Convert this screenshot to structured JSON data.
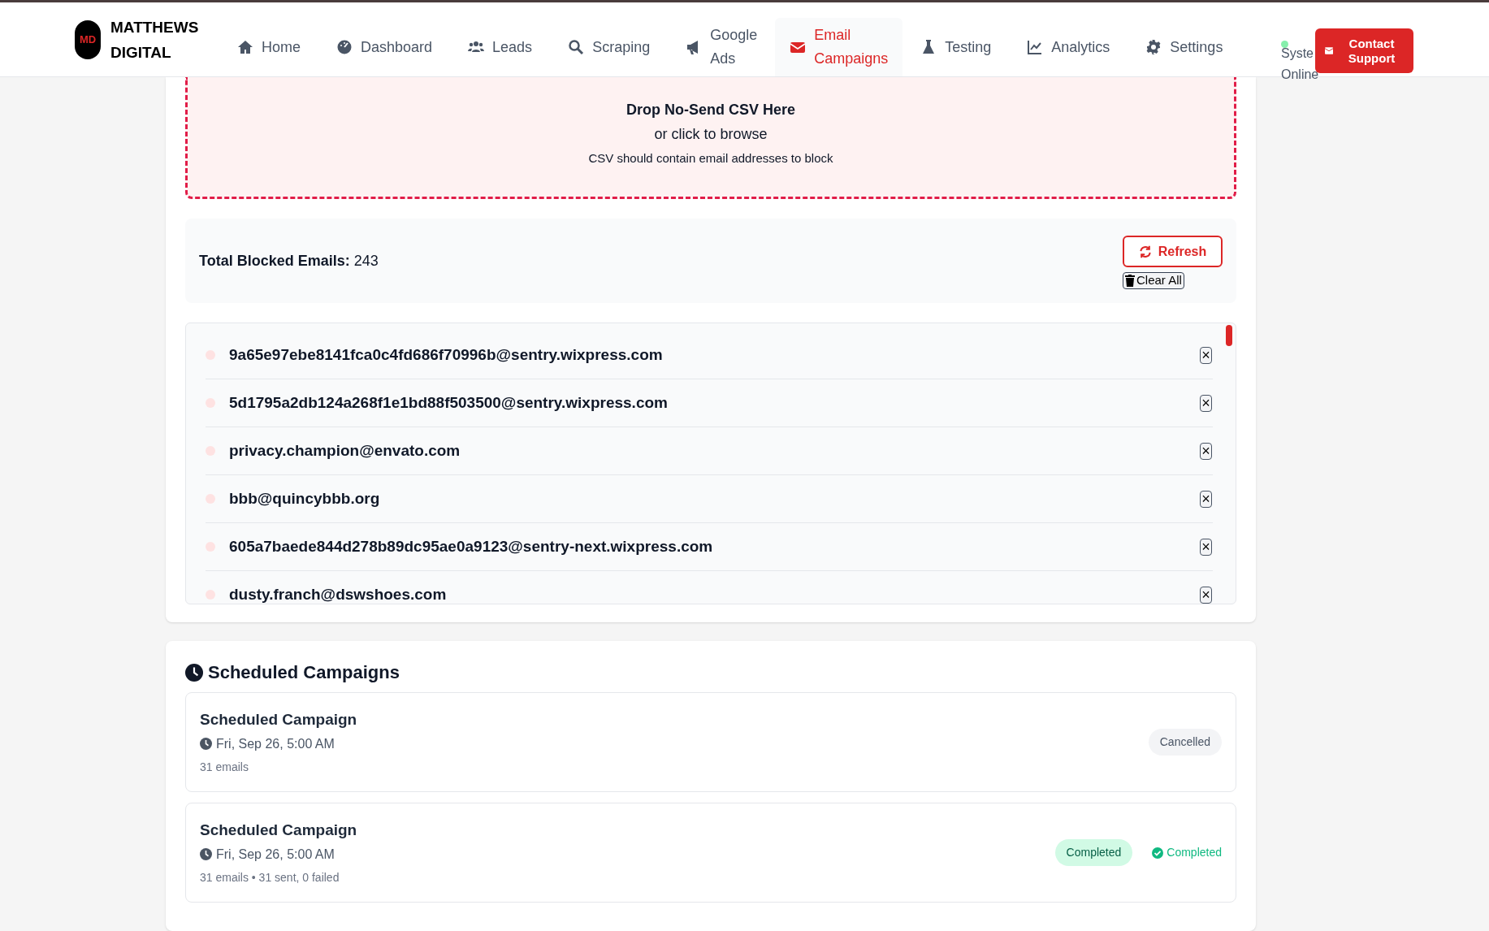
{
  "brand": {
    "logo": "MD",
    "name_lines": [
      "MATTHEWS",
      "DIGITAL"
    ]
  },
  "nav": [
    {
      "label": "Home",
      "selected": false
    },
    {
      "label": "Dashboard",
      "selected": false
    },
    {
      "label": "Leads",
      "selected": false
    },
    {
      "label": "Scraping",
      "selected": false
    },
    {
      "label": "Google Ads",
      "selected": false
    },
    {
      "label": "Email Campaigns",
      "selected": true
    },
    {
      "label": "Testing",
      "selected": false
    },
    {
      "label": "Analytics",
      "selected": false
    },
    {
      "label": "Settings",
      "selected": false
    }
  ],
  "status": {
    "online": true,
    "lines": [
      "Syste",
      "Online"
    ]
  },
  "contact_button": "Contact Support",
  "dropzone": {
    "title": "Drop No-Send CSV Here",
    "subtitle": "or click to browse",
    "hint": "CSV should contain email addresses to block"
  },
  "stats": {
    "label": "Total Blocked Emails:",
    "value": "243",
    "refresh": "Refresh",
    "clear": "Clear All"
  },
  "blocked_emails": [
    {
      "email": "9a65e97ebe8141fca0c4fd686f70996b@sentry.wixpress.com",
      "remove": "×"
    },
    {
      "email": "5d1795a2db124a268f1e1bd88f503500@sentry.wixpress.com",
      "remove": "×"
    },
    {
      "email": "privacy.champion@envato.com",
      "remove": "×"
    },
    {
      "email": "bbb@quincybbb.org",
      "remove": "×"
    },
    {
      "email": "605a7baede844d278b89dc95ae0a9123@sentry-next.wixpress.com",
      "remove": "×"
    },
    {
      "email": "dusty.franch@dswshoes.com",
      "remove": "×"
    }
  ],
  "scheduled": {
    "title": "Scheduled Campaigns",
    "campaigns": [
      {
        "name": "Scheduled Campaign",
        "time": "Fri, Sep 26, 5:00 AM",
        "detail": "31 emails",
        "badge": "Cancelled",
        "kind": "cancelled"
      },
      {
        "name": "Scheduled Campaign",
        "time": "Fri, Sep 26, 5:00 AM",
        "detail": "31 emails • 31 sent, 0 failed",
        "badge": "Completed",
        "kind": "completed",
        "status_text": "Completed"
      }
    ]
  }
}
